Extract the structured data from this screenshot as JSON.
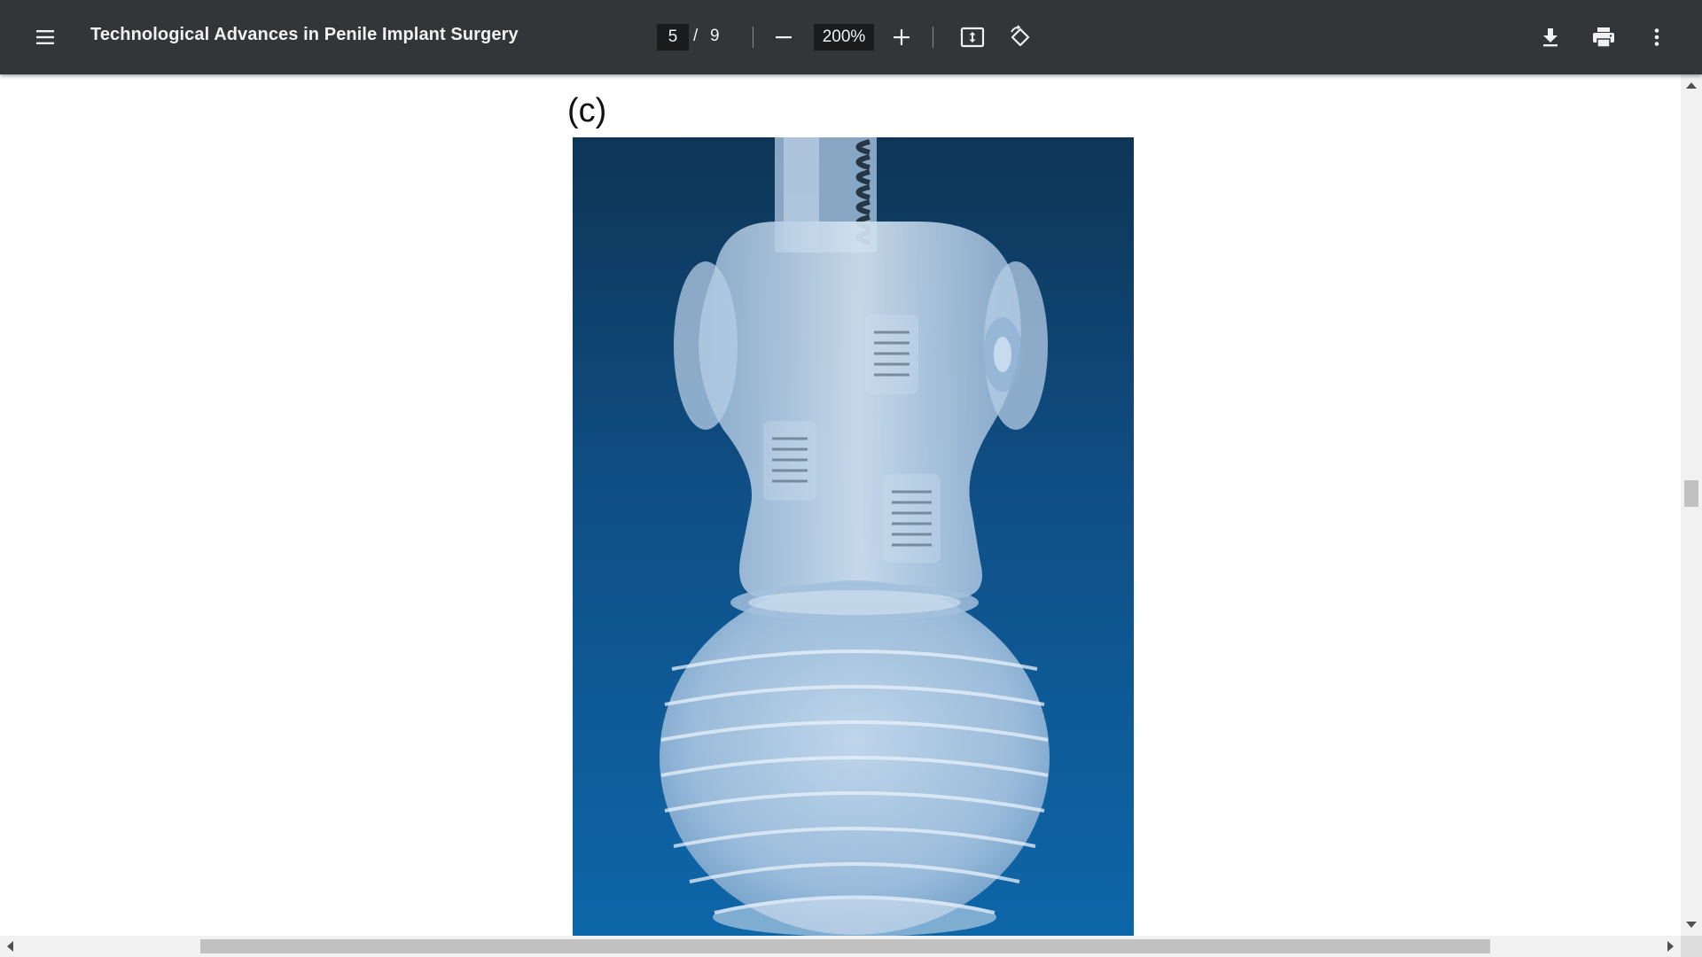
{
  "toolbar": {
    "menu_icon": "hamburger-menu-icon",
    "title": "Technological Advances in Penile Implant Surgery",
    "page_current": "5",
    "page_separator": "/",
    "page_total": "9",
    "zoom_value": "200%",
    "icons": {
      "zoom_out": "minus-icon",
      "zoom_in": "plus-icon",
      "fit": "fit-to-page-icon",
      "rotate": "rotate-counterclockwise-icon",
      "download": "download-icon",
      "print": "print-icon",
      "more": "more-vertical-icon"
    }
  },
  "document": {
    "figure_label": "(c)",
    "figure_image": "photo of a translucent silicone implant pump and valve assembly on a blue background"
  },
  "colors": {
    "toolbar_bg": "#323639",
    "toolbar_text": "#f1f1f1",
    "input_bg": "#191b1c",
    "page_bg": "#ffffff",
    "scrollbar_track": "#f1f1f1",
    "scrollbar_thumb": "#c1c1c1",
    "photo_bg_top": "#0e3556",
    "photo_bg_bottom": "#0d66a8"
  }
}
